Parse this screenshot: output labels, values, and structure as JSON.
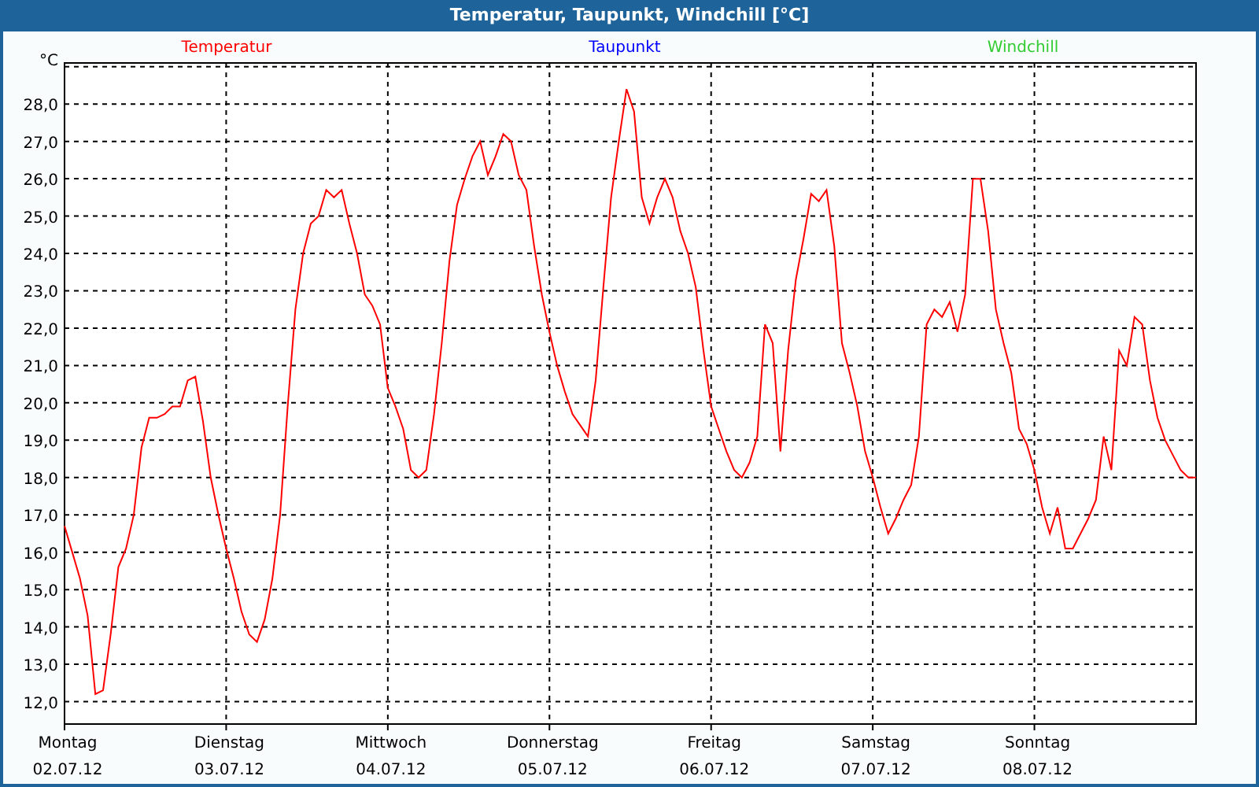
{
  "window": {
    "title": "Temperatur, Taupunkt, Windchill [°C]"
  },
  "legend": [
    {
      "label": "Taupunkt",
      "color": "#0000ff"
    },
    {
      "label": "Windchill",
      "color": "#33cc33"
    }
  ],
  "chart": {
    "date_labels": [
      "02.07.12",
      "03.07.12",
      "04.07.12",
      "05.07.12",
      "06.07.12",
      "07.07.12",
      "08.07.12"
    ],
    "chart_data": {
      "type": "line",
      "grid": true,
      "ylabel": "°C",
      "ylim": [
        11.4,
        29.1
      ],
      "yticks": [
        {
          "value": 12,
          "label": "12,0"
        },
        {
          "value": 13,
          "label": "13,0"
        },
        {
          "value": 14,
          "label": "14,0"
        },
        {
          "value": 15,
          "label": "15,0"
        },
        {
          "value": 16,
          "label": "16,0"
        },
        {
          "value": 17,
          "label": "17,0"
        },
        {
          "value": 18,
          "label": "18,0"
        },
        {
          "value": 19,
          "label": "19,0"
        },
        {
          "value": 20,
          "label": "20,0"
        },
        {
          "value": 21,
          "label": "21,0"
        },
        {
          "value": 22,
          "label": "22,0"
        },
        {
          "value": 23,
          "label": "23,0"
        },
        {
          "value": 24,
          "label": "24,0"
        },
        {
          "value": 25,
          "label": "25,0"
        },
        {
          "value": 26,
          "label": "26,0"
        },
        {
          "value": 27,
          "label": "27,0"
        },
        {
          "value": 28,
          "label": "28,0"
        }
      ],
      "categories": [
        "Montag",
        null,
        null,
        null,
        null,
        null,
        null,
        null,
        null,
        null,
        null,
        null,
        null,
        null,
        null,
        null,
        null,
        null,
        null,
        null,
        null,
        "Dienstag",
        null,
        null,
        null,
        null,
        null,
        null,
        null,
        null,
        null,
        null,
        null,
        null,
        null,
        null,
        null,
        null,
        null,
        null,
        null,
        null,
        "Mittwoch",
        null,
        null,
        null,
        null,
        null,
        null,
        null,
        null,
        null,
        null,
        null,
        null,
        null,
        null,
        null,
        null,
        null,
        null,
        null,
        null,
        "Donnerstag",
        null,
        null,
        null,
        null,
        null,
        null,
        null,
        null,
        null,
        null,
        null,
        null,
        null,
        null,
        null,
        null,
        null,
        null,
        null,
        null,
        "Freitag",
        null,
        null,
        null,
        null,
        null,
        null,
        null,
        null,
        null,
        null,
        null,
        null,
        null,
        null,
        null,
        null,
        null,
        null,
        null,
        null,
        "Samstag",
        null,
        null,
        null,
        null,
        null,
        null,
        null,
        null,
        null,
        null,
        null,
        null,
        null,
        null,
        null,
        null,
        null,
        null,
        null,
        null,
        "Sonntag",
        null,
        null,
        null,
        null,
        null,
        null,
        null,
        null,
        null,
        null,
        null,
        null,
        null,
        null,
        null,
        null,
        null,
        null,
        null,
        null,
        null
      ],
      "series": [
        {
          "name": "Temperatur",
          "color": "#ff0000",
          "values": [
            16.7,
            16.0,
            15.3,
            14.3,
            12.2,
            12.3,
            13.8,
            15.6,
            16.1,
            17.0,
            18.8,
            19.6,
            19.6,
            19.7,
            19.9,
            19.9,
            20.6,
            20.7,
            19.5,
            18.0,
            17.0,
            16.1,
            15.3,
            14.4,
            13.8,
            13.6,
            14.2,
            15.3,
            17.0,
            19.9,
            22.5,
            24.0,
            24.8,
            25.0,
            25.7,
            25.5,
            25.7,
            24.8,
            24.0,
            22.9,
            22.6,
            22.1,
            20.4,
            19.9,
            19.3,
            18.2,
            18.0,
            18.2,
            19.7,
            21.6,
            23.8,
            25.3,
            26.0,
            26.6,
            27.0,
            26.1,
            26.6,
            27.2,
            27.0,
            26.1,
            25.7,
            24.2,
            22.9,
            21.9,
            21.0,
            20.3,
            19.7,
            19.4,
            19.1,
            20.6,
            23.1,
            25.5,
            27.0,
            28.4,
            27.8,
            25.5,
            24.8,
            25.5,
            26.0,
            25.5,
            24.6,
            24.0,
            23.1,
            21.4,
            19.9,
            19.3,
            18.7,
            18.2,
            18.0,
            18.4,
            19.1,
            22.1,
            21.6,
            18.7,
            21.4,
            23.3,
            24.4,
            25.6,
            25.4,
            25.7,
            24.2,
            21.6,
            20.8,
            19.9,
            18.7,
            18.0,
            17.2,
            16.5,
            16.9,
            17.4,
            17.8,
            19.1,
            22.1,
            22.5,
            22.3,
            22.7,
            21.9,
            22.9,
            26.0,
            26.0,
            24.6,
            22.5,
            21.6,
            20.8,
            19.3,
            18.9,
            18.2,
            17.2,
            16.5,
            17.2,
            16.1,
            16.1,
            16.5,
            16.9,
            17.4,
            19.1,
            18.2,
            21.4,
            21.0,
            22.3,
            22.1,
            20.6,
            19.6,
            19.0,
            18.6,
            18.2,
            18.0,
            18.0
          ]
        }
      ]
    }
  }
}
